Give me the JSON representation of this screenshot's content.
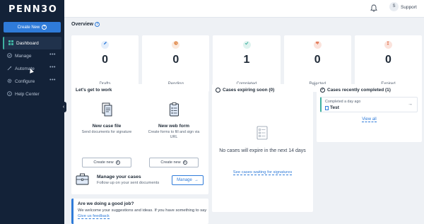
{
  "app": {
    "logo": "PENN3O"
  },
  "sidebar": {
    "create_label": "Create New",
    "items": [
      {
        "label": "Dashboard",
        "icon": "dashboard-icon",
        "active": true
      },
      {
        "label": "Manage",
        "icon": "check-circle-icon"
      },
      {
        "label": "Automate",
        "icon": "wand-icon"
      },
      {
        "label": "Configure",
        "icon": "gear-icon"
      },
      {
        "label": "Help Center",
        "icon": "question-circle-icon"
      }
    ],
    "more": "•••"
  },
  "topbar": {
    "avatar_initial": "S",
    "user": "Support"
  },
  "overview": {
    "title": "Overview",
    "help": "?",
    "stats": [
      {
        "value": "0",
        "label": "Drafts",
        "icon": "pencil-icon",
        "color": "#2f7bd9",
        "bg": "#e4eefb"
      },
      {
        "value": "0",
        "label": "Pending",
        "icon": "clock-icon",
        "color": "#e08a4b",
        "bg": "#fbe9dd"
      },
      {
        "value": "1",
        "label": "Completed",
        "icon": "check-icon",
        "color": "#3fb0a0",
        "bg": "#dff3ef"
      },
      {
        "value": "0",
        "label": "Rejected",
        "icon": "thumbs-down-icon",
        "color": "#e0704b",
        "bg": "#fbe3dc"
      },
      {
        "value": "0",
        "label": "Expired",
        "icon": "hourglass-icon",
        "color": "#e0704b",
        "bg": "#fbe3dc"
      }
    ]
  },
  "work": {
    "title": "Let's get to work",
    "case_file": {
      "title": "New case file",
      "desc": "Send documents for signature",
      "button": "Create new"
    },
    "web_form": {
      "title": "New web form",
      "desc": "Create forms to fill and sign via URL",
      "button": "Create new"
    }
  },
  "expiring": {
    "title": "Cases expiring soon (0)",
    "message": "No cases will expire in the next 14 days",
    "link": "See cases waiting for signatures"
  },
  "completed": {
    "title": "Cases recently completed (1)",
    "item_when": "Completed a day ago",
    "item_name": "Test",
    "view_all": "View all"
  },
  "manage": {
    "title": "Manage your cases",
    "subtitle": "Follow up on your sent documents",
    "button": "Manage"
  },
  "feedback": {
    "title": "Are we doing a good job?",
    "text": "We welcome your suggestions and ideas. If you have something to say",
    "link": "Give us feedback"
  },
  "symbols": {
    "arrow": "→",
    "plus": "+",
    "check": "✓",
    "chevron_left": "‹"
  }
}
